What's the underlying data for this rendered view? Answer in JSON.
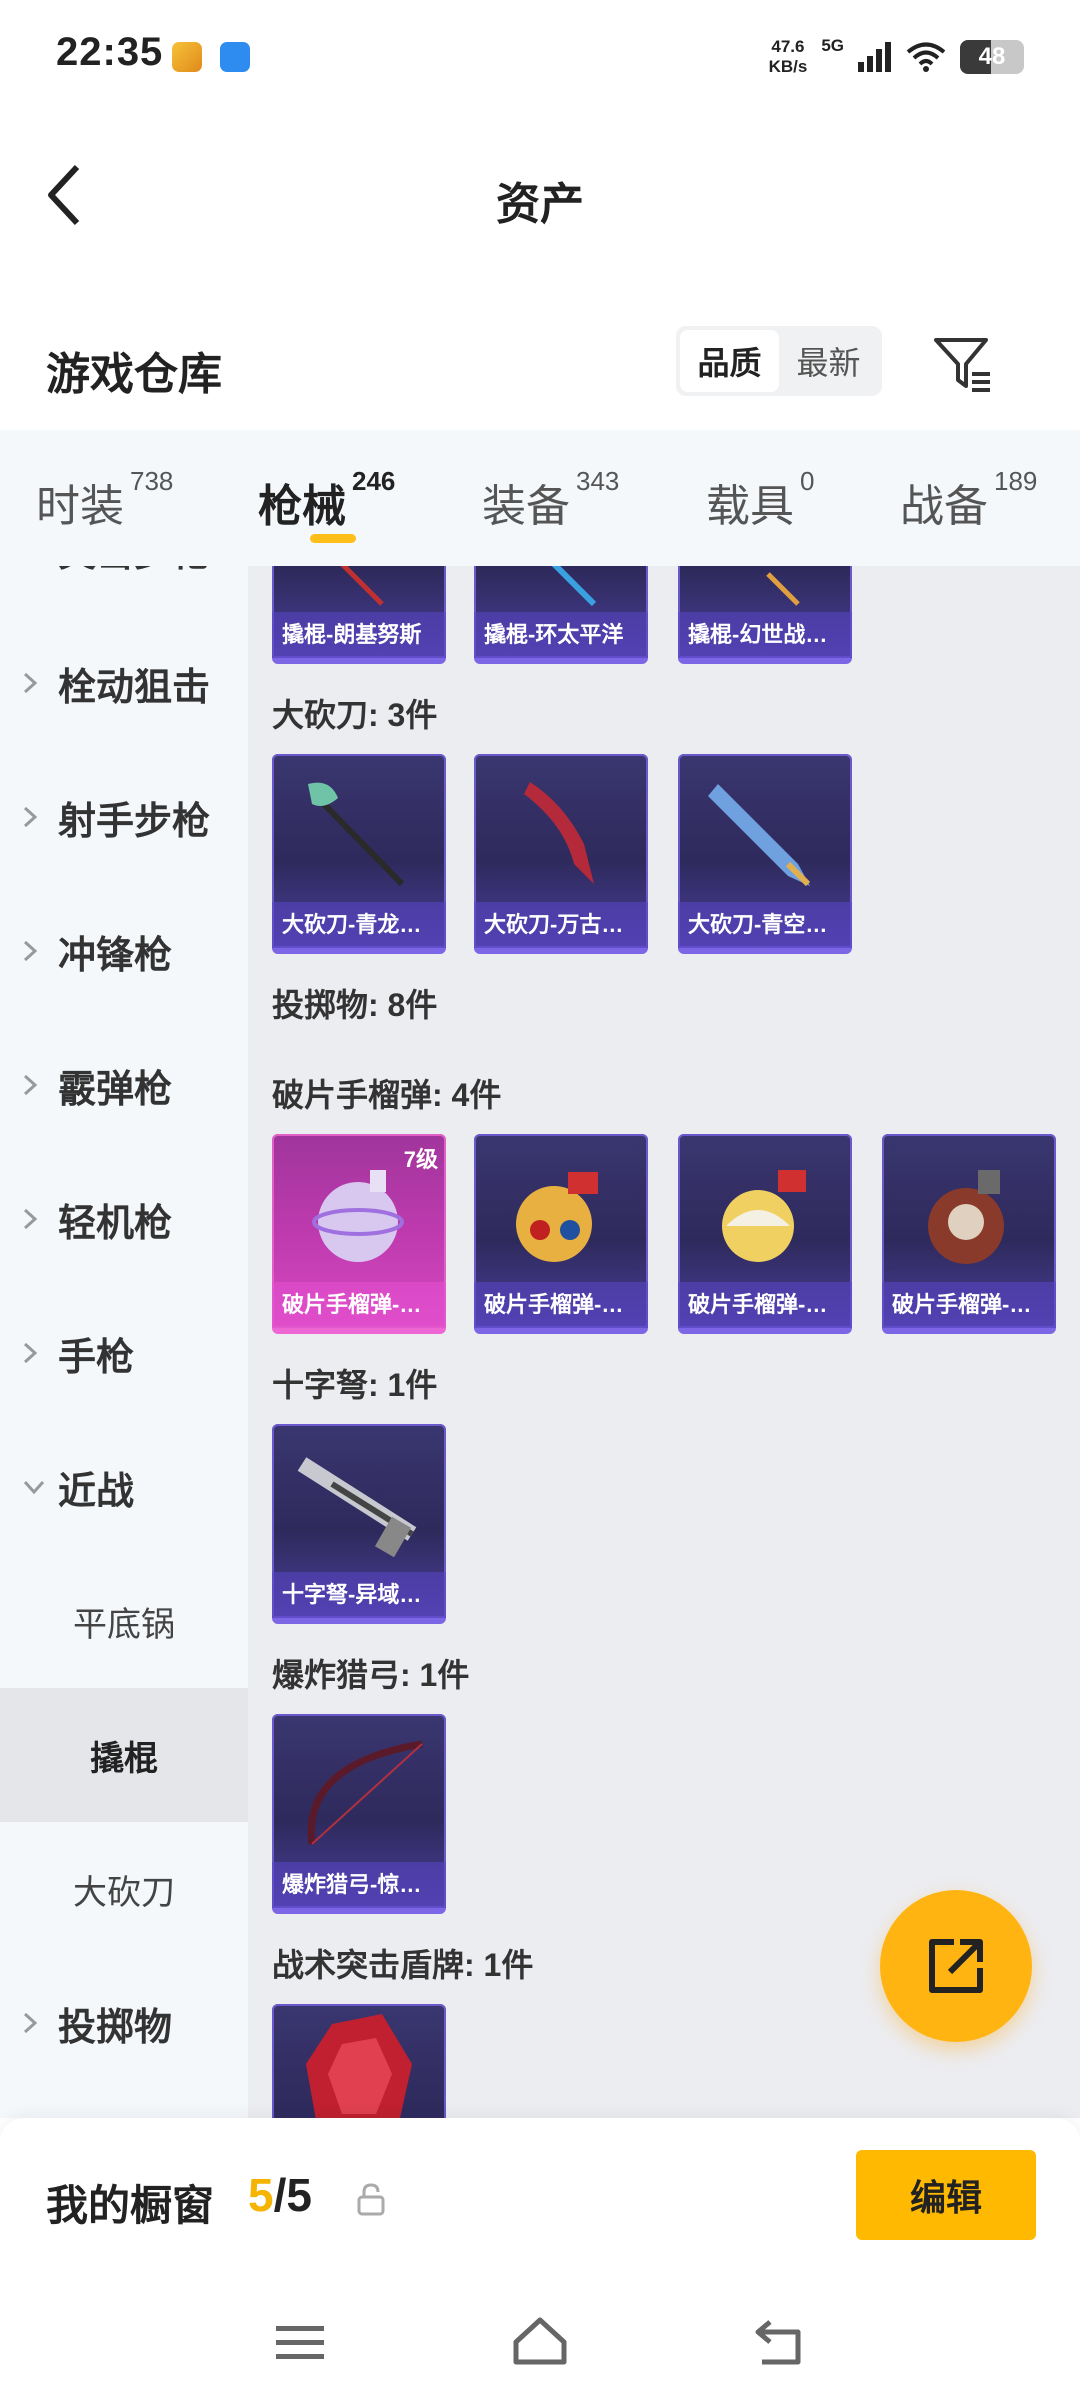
{
  "status_bar": {
    "time": "22:35",
    "net_speed_value": "47.6",
    "net_speed_unit": "KB/s",
    "network_type": "5G",
    "battery": "48",
    "battery_level": 0.48
  },
  "header": {
    "title": "资产"
  },
  "warehouse": {
    "title": "游戏仓库",
    "sort_options": [
      "品质",
      "最新"
    ],
    "sort_selected": "品质"
  },
  "category_tabs": [
    {
      "label": "时装",
      "count": "738"
    },
    {
      "label": "枪械",
      "count": "246",
      "active": true
    },
    {
      "label": "装备",
      "count": "343"
    },
    {
      "label": "载具",
      "count": "0"
    },
    {
      "label": "战备",
      "count": "189"
    }
  ],
  "sidebar": {
    "items": [
      {
        "label": "突击步枪",
        "expanded": false
      },
      {
        "label": "栓动狙击",
        "expanded": false
      },
      {
        "label": "射手步枪",
        "expanded": false
      },
      {
        "label": "冲锋枪",
        "expanded": false
      },
      {
        "label": "霰弹枪",
        "expanded": false
      },
      {
        "label": "轻机枪",
        "expanded": false
      },
      {
        "label": "手枪",
        "expanded": false
      },
      {
        "label": "近战",
        "expanded": true
      },
      {
        "label": "平底锅",
        "sub": true
      },
      {
        "label": "撬棍",
        "sub": true,
        "active": true
      },
      {
        "label": "大砍刀",
        "sub": true
      },
      {
        "label": "投掷物",
        "expanded": false
      }
    ]
  },
  "sections": {
    "crowbar_cards": [
      "撬棍-朗基努斯",
      "撬棍-环太平洋",
      "撬棍-幻世战…"
    ],
    "machete": {
      "header": "大砍刀: 3件",
      "cards": [
        "大砍刀-青龙…",
        "大砍刀-万古…",
        "大砍刀-青空…"
      ]
    },
    "throwables": {
      "header": "投掷物: 8件"
    },
    "grenade": {
      "header": "破片手榴弹: 4件",
      "cards": [
        {
          "label": "破片手榴弹-…",
          "badge": "7级"
        },
        {
          "label": "破片手榴弹-…"
        },
        {
          "label": "破片手榴弹-…"
        },
        {
          "label": "破片手榴弹-…"
        }
      ]
    },
    "crossbow": {
      "header": "十字弩: 1件",
      "cards": [
        "十字弩-异域…"
      ]
    },
    "bow": {
      "header": "爆炸猎弓: 1件",
      "cards": [
        "爆炸猎弓-惊…"
      ]
    },
    "shield": {
      "header": "战术突击盾牌: 1件"
    }
  },
  "showcase": {
    "title": "我的橱窗",
    "current": "5",
    "total": "/5",
    "edit_label": "编辑"
  },
  "icons": {
    "back": "back-arrow-icon",
    "filter": "filter-icon",
    "share": "share-external-icon",
    "lock": "lock-icon",
    "nav": [
      "menu-icon",
      "home-icon",
      "back-icon"
    ]
  },
  "colors": {
    "accent": "#ffb900",
    "tab_indicator": "#ffbe1a",
    "card_purple": "#3a3670",
    "card_pink": "#c03bb0"
  }
}
